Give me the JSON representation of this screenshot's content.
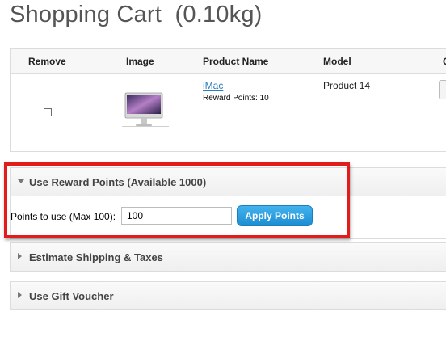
{
  "page": {
    "title": "Shopping Cart",
    "weight": "(0.10kg)"
  },
  "cart": {
    "headers": {
      "remove": "Remove",
      "image": "Image",
      "product_name": "Product Name",
      "model": "Model",
      "quantity_partial": "Q"
    },
    "rows": [
      {
        "remove_checked": false,
        "image_icon": "imac-product-image",
        "product_name": "iMac",
        "reward_points": "Reward Points: 10",
        "model": "Product 14"
      }
    ]
  },
  "reward_panel": {
    "title": "Use Reward Points (Available 1000)",
    "points_label": "Points to use (Max 100):",
    "points_value": "100",
    "apply_label": "Apply Points"
  },
  "shipping_panel": {
    "title": "Estimate Shipping & Taxes"
  },
  "voucher_panel": {
    "title": "Use Gift Voucher"
  },
  "colors": {
    "highlight": "#e21b1b",
    "accent": "#1d8dd2",
    "link": "#2b7fc0"
  }
}
